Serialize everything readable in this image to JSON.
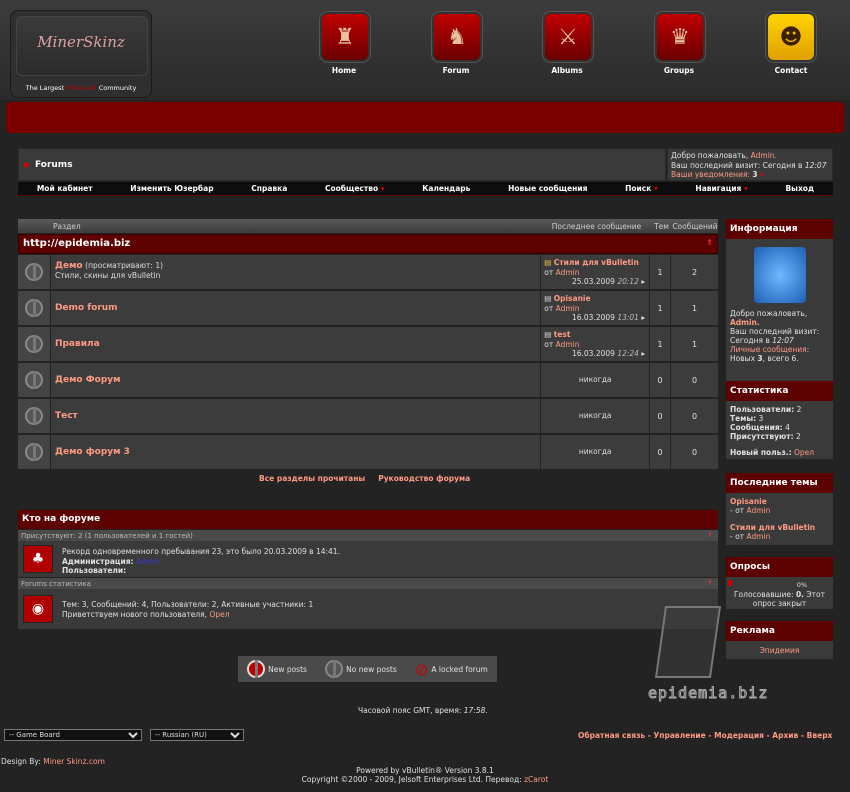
{
  "header": {
    "logo_name": "MinerSkinz",
    "logo_sub_pre": "The Largest",
    "logo_sub_mid": "Minecraft",
    "logo_sub_post": "Community",
    "nav": [
      {
        "label": "Home",
        "icon": "bowser-icon"
      },
      {
        "label": "Forum",
        "icon": "fox-icon"
      },
      {
        "label": "Albums",
        "icon": "link-icon"
      },
      {
        "label": "Groups",
        "icon": "samus-icon"
      },
      {
        "label": "Contact",
        "icon": "pikachu-icon"
      }
    ]
  },
  "breadcrumb": {
    "title": "Forums"
  },
  "welcome": {
    "greeting": "Добро пожаловать,",
    "user": "Admin.",
    "last_visit": "Ваш последний визит: Сегодня в",
    "last_visit_time": "12:07",
    "notifications": "Ваши уведомления:",
    "notif_count": "3"
  },
  "menu": [
    "Мой кабинет",
    "Изменить Юзербар",
    "Справка",
    "Сообщество",
    "Календарь",
    "Новые сообщения",
    "Поиск",
    "Навигация",
    "Выход"
  ],
  "table": {
    "col_section": "Раздел",
    "col_last": "Последнее сообщение",
    "col_threads": "Тем",
    "col_posts": "Сообщений",
    "category": "http://epidemia.biz",
    "rows": [
      {
        "name": "Демо",
        "viewing": "(просматривают: 1)",
        "desc": "Стили, скины для vBulletin",
        "last_title": "Стили для vBulletin",
        "last_by": "от",
        "last_user": "Admin",
        "last_date": "25.03.2009",
        "last_time": "20:12",
        "threads": "1",
        "posts": "2"
      },
      {
        "name": "Demo forum",
        "viewing": "",
        "desc": "",
        "last_title": "Opisanie",
        "last_by": "от",
        "last_user": "Admin",
        "last_date": "16.03.2009",
        "last_time": "13:01",
        "threads": "1",
        "posts": "1"
      },
      {
        "name": "Правила",
        "viewing": "",
        "desc": "",
        "last_title": "test",
        "last_by": "от",
        "last_user": "Admin",
        "last_date": "16.03.2009",
        "last_time": "12:24",
        "threads": "1",
        "posts": "1"
      },
      {
        "name": "Демо Форум",
        "viewing": "",
        "desc": "",
        "never": "никогда",
        "threads": "0",
        "posts": "0"
      },
      {
        "name": "Тест",
        "viewing": "",
        "desc": "",
        "never": "никогда",
        "threads": "0",
        "posts": "0"
      },
      {
        "name": "Демо форум 3",
        "viewing": "",
        "desc": "",
        "never": "никогда",
        "threads": "0",
        "posts": "0"
      }
    ],
    "mark_read": "Все разделы прочитаны",
    "leaders": "Руководство форума"
  },
  "sidebar": {
    "info_title": "Информация",
    "info_greeting": "Добро пожаловать,",
    "info_user": "Admin.",
    "info_visit": "Ваш последний визит: Сегодня в",
    "info_time": "12:07",
    "info_pm": "Личные сообщения",
    "info_new": "Новых",
    "info_new_count": "3",
    "info_total": ", всего 6.",
    "stats_title": "Статистика",
    "stats": [
      {
        "k": "Пользователи:",
        "v": "2"
      },
      {
        "k": "Темы:",
        "v": "3"
      },
      {
        "k": "Сообщения:",
        "v": "4"
      },
      {
        "k": "Присутствуют:",
        "v": "2"
      }
    ],
    "new_user_label": "Новый польз.:",
    "new_user": "Орел",
    "latest_title": "Последние темы",
    "latest": [
      {
        "title": "Opisanie",
        "by": "- от",
        "user": "Admin"
      },
      {
        "title": "Стили для vBulletin",
        "by": "- от",
        "user": "Admin"
      }
    ],
    "polls_title": "Опросы",
    "poll_pct": "0%",
    "poll_voted": "Голосовавшие:",
    "poll_voted_count": "0.",
    "poll_closed": "Этот опрос закрыт",
    "ads_title": "Реклама",
    "ads_link": "Эпидемия"
  },
  "who": {
    "title": "Кто на форуме",
    "present": "Присутствуют: 2 (1 пользователей и 1 гостей)",
    "record": "Рекорд одновременного пребывания 23, это было 20.03.2009 в 14:41.",
    "admin_label": "Администрация:",
    "admin_name": "Admin",
    "users_label": "Пользователи:",
    "stats_title": "Forums статистика",
    "stats_line": "Тем: 3, Сообщений: 4, Пользователи: 2, Активные участники: 1",
    "welcome_new": "Приветствуем нового пользователя,",
    "new_user": "Орел"
  },
  "legend": {
    "new": "New posts",
    "nonew": "No new posts",
    "locked": "A locked forum"
  },
  "timezone": {
    "text": "Часовой пояс GMT, время:",
    "time": "17:58."
  },
  "watermark": "epidemia.biz",
  "footer": {
    "style_select": "-- Game Board",
    "lang_select": "-- Russian (RU)",
    "links": [
      "Обратная связь",
      "Управление",
      "Модерация",
      "Архив",
      "Вверх"
    ],
    "design_by": "Design By:",
    "design_link": "Miner Skinz.com",
    "powered": "Powered by vBulletin® Version 3.8.1",
    "copyright": "Copyright ©2000 - 2009, Jelsoft Enterprises Ltd. Перевод:",
    "translator": "zCarot"
  }
}
